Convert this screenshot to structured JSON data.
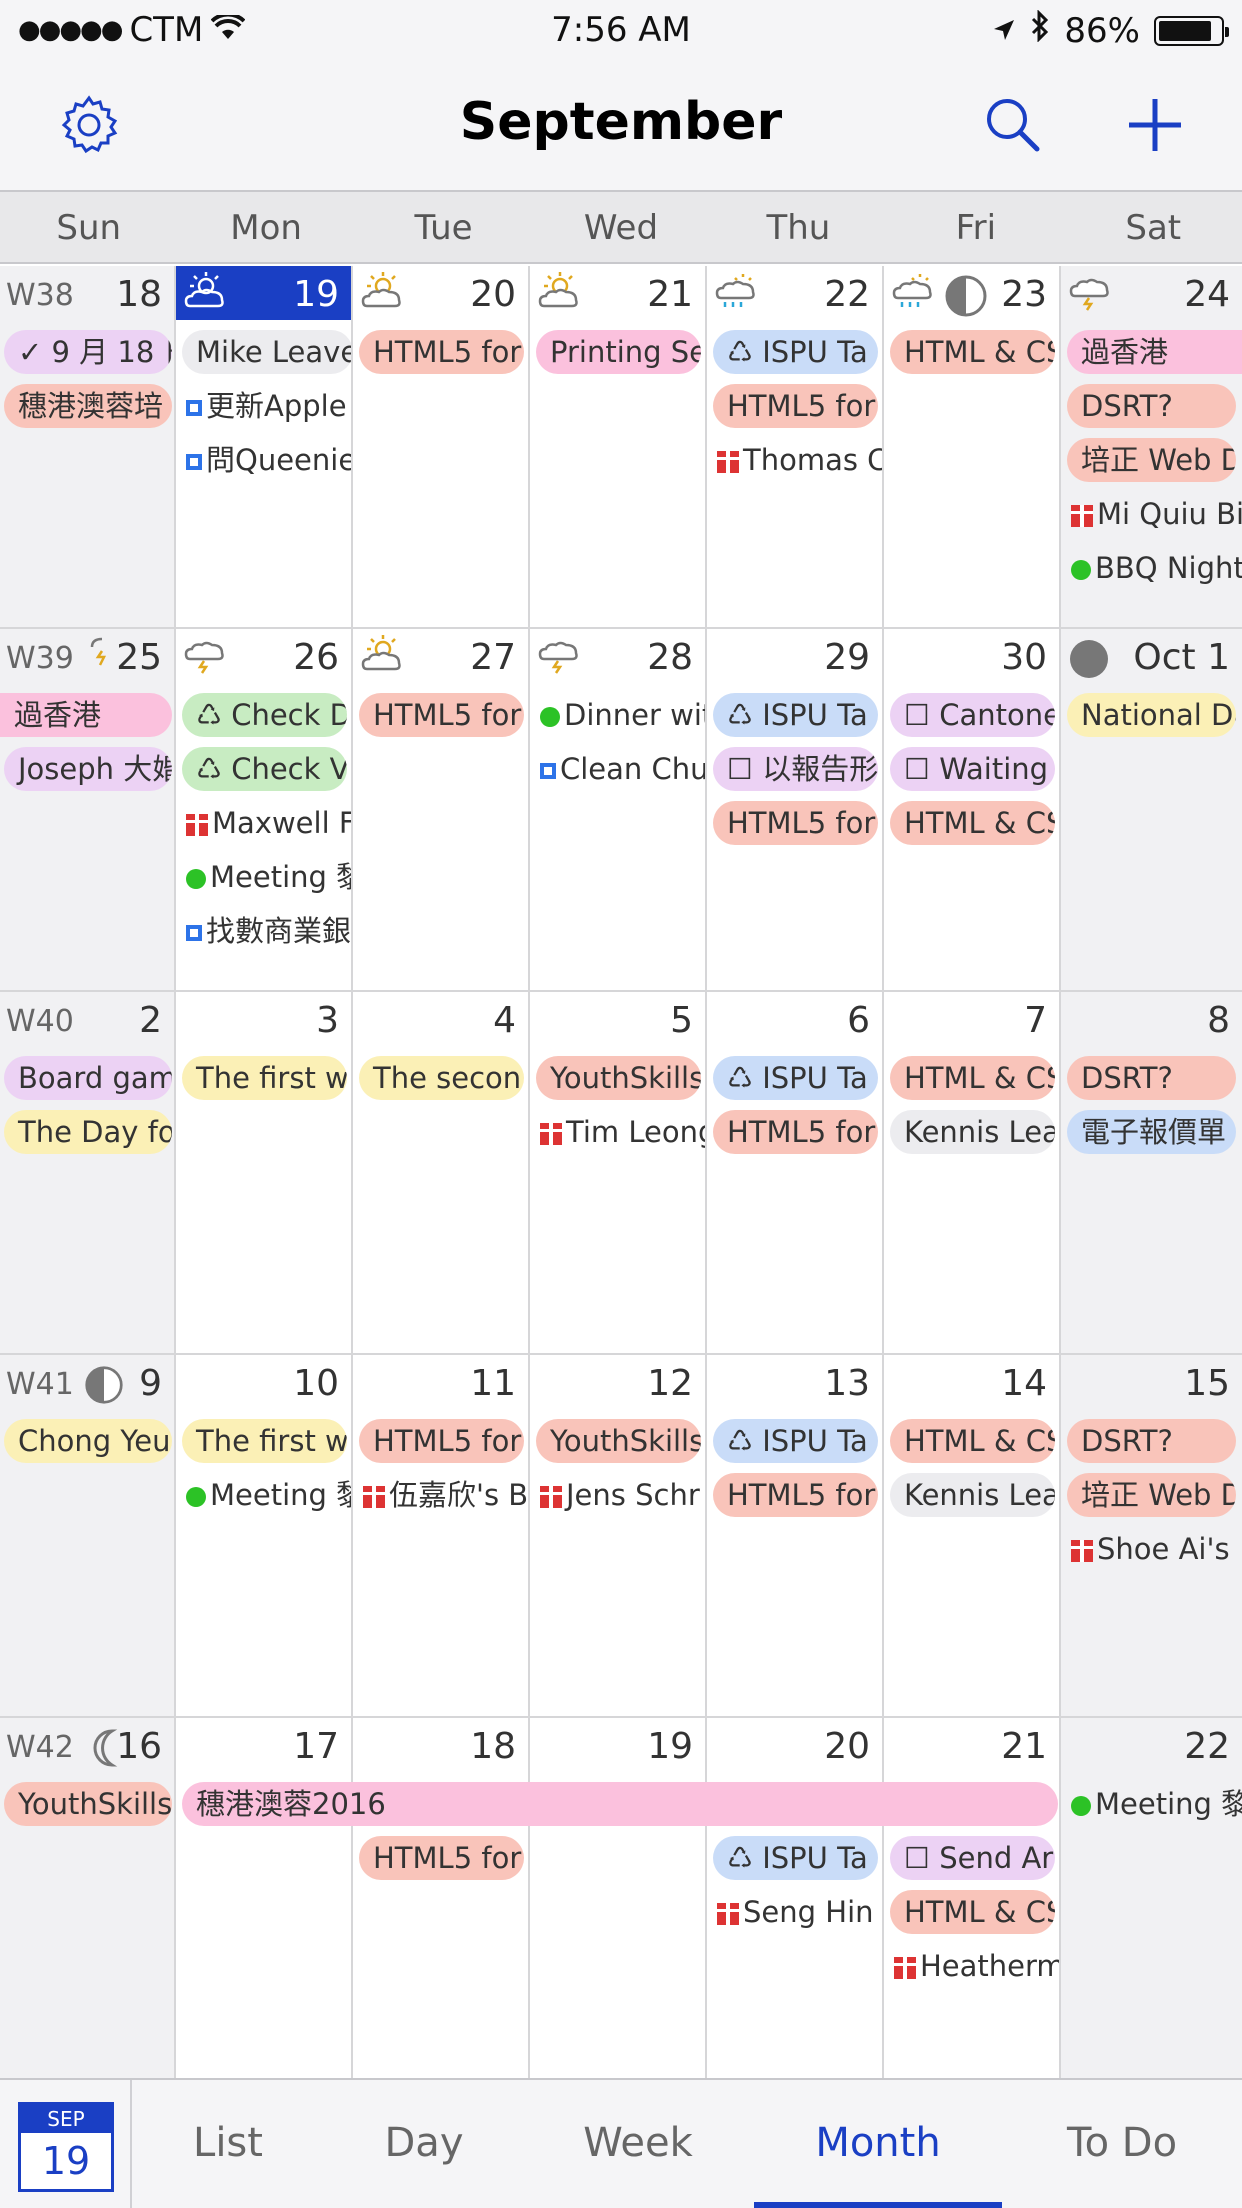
{
  "status": {
    "carrier": "CTM",
    "time": "7:56 AM",
    "battery": "86%",
    "battery_level": 0.86
  },
  "nav": {
    "title": "September"
  },
  "weekdays": [
    "Sun",
    "Mon",
    "Tue",
    "Wed",
    "Thu",
    "Fri",
    "Sat"
  ],
  "weeks": [
    {
      "label": "W38",
      "days": [
        "18",
        "19",
        "20",
        "21",
        "22",
        "23",
        "24"
      ]
    },
    {
      "label": "W39",
      "days": [
        "25",
        "26",
        "27",
        "28",
        "29",
        "30",
        "Oct 1"
      ]
    },
    {
      "label": "W40",
      "days": [
        "2",
        "3",
        "4",
        "5",
        "6",
        "7",
        "8"
      ]
    },
    {
      "label": "W41",
      "days": [
        "9",
        "10",
        "11",
        "12",
        "13",
        "14",
        "15"
      ]
    },
    {
      "label": "W42",
      "days": [
        "16",
        "17",
        "18",
        "19",
        "20",
        "21",
        "22"
      ]
    }
  ],
  "events": {
    "w0": [
      [
        "✓ 9 月 18 日",
        "穗港澳蓉培"
      ],
      [
        "Mike Leave",
        "更新Apple",
        "問Queenie"
      ],
      [
        "HTML5 for"
      ],
      [
        "Printing Se"
      ],
      [
        "♺ ISPU Ta",
        "HTML5 for",
        "Thomas C"
      ],
      [
        "HTML & CS"
      ],
      [
        "過香港",
        "DSRT?",
        "培正 Web D",
        "Mi Quiu Bi",
        "BBQ Night"
      ]
    ],
    "w1": [
      [
        "過香港",
        "Joseph 大婚"
      ],
      [
        "♺ Check D",
        "♺ Check V",
        "Maxwell F",
        "Meeting 黎",
        "找數商業銀"
      ],
      [
        "HTML5 for"
      ],
      [
        "Dinner wit",
        "Clean Chu"
      ],
      [
        "♺ ISPU Ta",
        "☐ 以報告形",
        "HTML5 for"
      ],
      [
        "☐ Cantone",
        "☐ Waiting",
        "HTML & CS"
      ],
      [
        "National Da"
      ]
    ],
    "w2": [
      [
        "Board gam",
        "The Day fo"
      ],
      [
        "The first w"
      ],
      [
        "The secon"
      ],
      [
        "YouthSkills",
        "Tim Leong"
      ],
      [
        "♺ ISPU Ta",
        "HTML5 for"
      ],
      [
        "HTML & CS",
        "Kennis Lea"
      ],
      [
        "DSRT?",
        "電子報價單"
      ]
    ],
    "w3": [
      [
        "Chong Yeu"
      ],
      [
        "The first w",
        "Meeting 黎"
      ],
      [
        "HTML5 for",
        "伍嘉欣's B"
      ],
      [
        "YouthSkills",
        "Jens Schr"
      ],
      [
        "♺ ISPU Ta",
        "HTML5 for"
      ],
      [
        "HTML & CS",
        "Kennis Lea"
      ],
      [
        "DSRT?",
        "培正 Web D",
        "Shoe Ai's"
      ]
    ],
    "w4": [
      [
        "YouthSkills"
      ],
      [
        "穗港澳蓉2016"
      ],
      [
        "HTML5 for"
      ],
      [],
      [
        "♺ ISPU Ta",
        "Seng Hin"
      ],
      [
        "☐ Send Ar",
        "HTML & CS",
        "Heatherm"
      ],
      [
        "Meeting 黎"
      ]
    ]
  },
  "tabbar": {
    "badge_month": "SEP",
    "badge_day": "19",
    "tabs": [
      "List",
      "Day",
      "Week",
      "Month",
      "To Do"
    ],
    "active_tab": "Month"
  },
  "colors": {
    "accent": "#1a3fc4",
    "red": "#f9c4ba",
    "pink": "#fbc1dd",
    "purple": "#ecd2f4",
    "blue": "#c9dcf8",
    "yellow": "#fbf0b6",
    "green": "#c8ecc2",
    "gray": "#ececef"
  },
  "icons": [
    "settings-gear-icon",
    "search-icon",
    "add-plus-icon",
    "wifi-icon",
    "location-arrow-icon",
    "bluetooth-icon",
    "battery-icon",
    "sunny-cloud-icon",
    "rain-cloud-icon",
    "thunder-cloud-icon",
    "moon-phase-icon",
    "gift-icon",
    "checkbox-icon",
    "recycle-icon"
  ]
}
